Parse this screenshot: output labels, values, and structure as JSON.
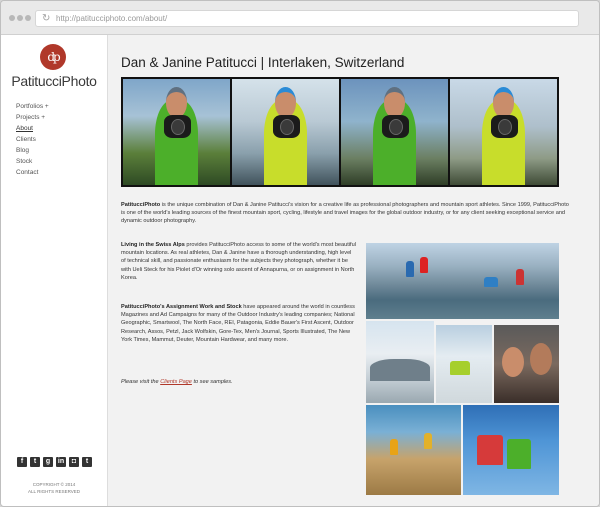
{
  "browser": {
    "url": "http://patitucciphoto.com/about/"
  },
  "sidebar": {
    "logo_text": "dp",
    "brand": "PatitucciPhoto",
    "nav": [
      {
        "label": "Portfolios +",
        "active": false
      },
      {
        "label": "Projects +",
        "active": false
      },
      {
        "label": "About",
        "active": true
      },
      {
        "label": "Clients",
        "active": false
      },
      {
        "label": "Blog",
        "active": false
      },
      {
        "label": "Stock",
        "active": false
      },
      {
        "label": "Contact",
        "active": false
      }
    ],
    "social_icons": [
      "facebook-icon",
      "twitter-icon",
      "google-plus-icon",
      "linkedin-icon",
      "instagram-icon",
      "tumblr-icon"
    ],
    "copyright_line1": "COPYRIGHT © 2014",
    "copyright_line2": "ALL RIGHTS RESERVED"
  },
  "main": {
    "title": "Dan & Janine Patitucci | Interlaken, Switzerland",
    "p1_bold": "PatitucciPhoto",
    "p1_text": " is the unique combination of Dan & Janine Patitucci's vision for a creative life as professional photographers and mountain sport athletes. Since 1999, PatitucciPhoto is one of the world's leading sources of the finest mountain sport, cycling, lifestyle and travel images for the global outdoor industry, or for any client seeking exceptional service and dynamic outdoor photography.",
    "p2_bold": "Living in the Swiss Alps",
    "p2_text": " provides PatitucciPhoto access to some of the world's most beautiful mountain locations. As real athletes, Dan & Janine have a thorough understanding, high level of technical skill, and passionate enthusiasm for the subjects they photograph, whether it be with Ueli Steck for his Piolet d'Or winning solo ascent of Annapurna, or on assignment in North Korea.",
    "p3_bold": "PatitucciPhoto's Assignment Work and Stock",
    "p3_text": " have appeared around the world in countless Magazines and Ad Campaigns for many of the Outdoor Industry's leading companies; National Geographic, Smartwool, The North Face, REI, Patagonia, Eddie Bauer's First Ascent, Outdoor Research, Assos, Petzl, Jack Wolfskin, Gore-Tex, Men's Journal, Sports Illustrated, The New York Times, Mammut, Deuter, Mountain Hardwear, and many more.",
    "p4_pre": "Please visit the ",
    "p4_link": "Clients Page",
    "p4_post": " to see samples."
  }
}
